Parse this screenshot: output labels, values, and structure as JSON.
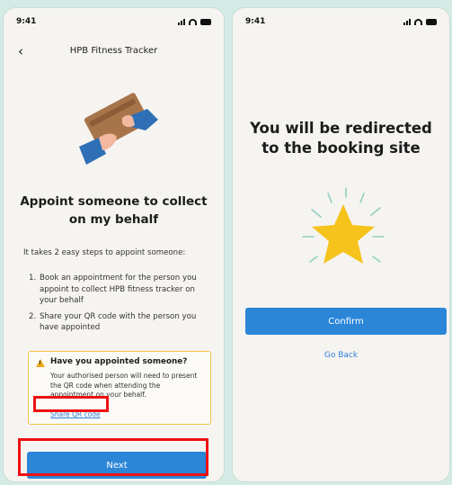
{
  "left_screen": {
    "status": {
      "time": "9:41"
    },
    "header": {
      "title": "HPB Fitness Tracker",
      "back_icon": "‹"
    },
    "title": "Appoint someone to collect on my behalf",
    "intro": "It takes 2 easy steps to appoint someone:",
    "steps": [
      {
        "num": "1.",
        "text": "Book an appointment for the person you appoint to collect HPB fitness tracker on your behalf"
      },
      {
        "num": "2.",
        "text": "Share your QR code with the person you have appointed"
      }
    ],
    "info_card": {
      "icon": "warning-icon",
      "title": "Have you appointed someone?",
      "body": "Your authorised person will need to present the QR code when attending the appointment on your behalf.",
      "link": "Share QR code"
    },
    "next_label": "Next"
  },
  "right_screen": {
    "status": {
      "time": "9:41"
    },
    "title": "You will be redirected to the booking site",
    "confirm_label": "Confirm",
    "go_back_label": "Go Back"
  },
  "colors": {
    "background": "#d4ebe5",
    "primary": "#2b86d8",
    "link": "#2f7fd9",
    "warning": "#f1c44a",
    "star": "#f6c21c",
    "highlight": "#ee1111"
  }
}
